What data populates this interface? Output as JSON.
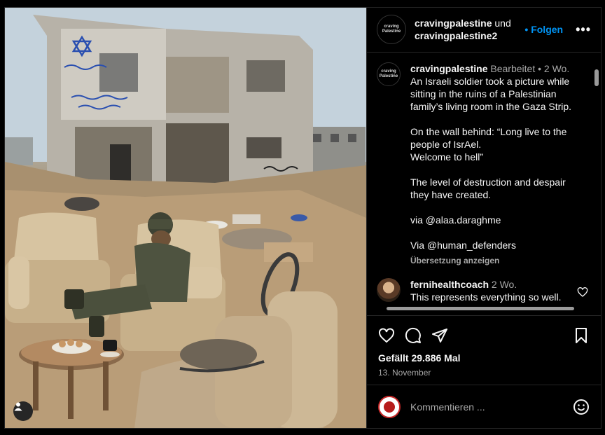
{
  "header": {
    "user1": "cravingpalestine",
    "conj": "und",
    "user2": "cravingpalestine2",
    "follow": "• Folgen",
    "more": "•••",
    "avatar_text": "craving Palestine"
  },
  "caption": {
    "user": "cravingpalestine",
    "meta": "Bearbeitet • 2 Wo.",
    "text": "An Israeli soldier took a picture while sitting in the ruins of a Palestinian family’s living room in the Gaza Strip.\n\nOn the wall behind: “Long live to the people of IsrAel.\nWelcome to hell”\n\nThe level of destruction and despair they have created.\n\nvia @alaa.daraghme\n\nVia @human_defenders",
    "translate": "Übersetzung anzeigen"
  },
  "comment": {
    "user": "fernihealthcoach",
    "meta": "2 Wo.",
    "text": "This represents everything so well."
  },
  "stats": {
    "likes": "Gefällt 29.886 Mal",
    "date": "13. November"
  },
  "add_comment": {
    "placeholder": "Kommentieren ..."
  },
  "icons": [
    "heart-icon",
    "comment-icon",
    "share-icon",
    "bookmark-icon",
    "emoji-icon",
    "user-tag-icon"
  ]
}
